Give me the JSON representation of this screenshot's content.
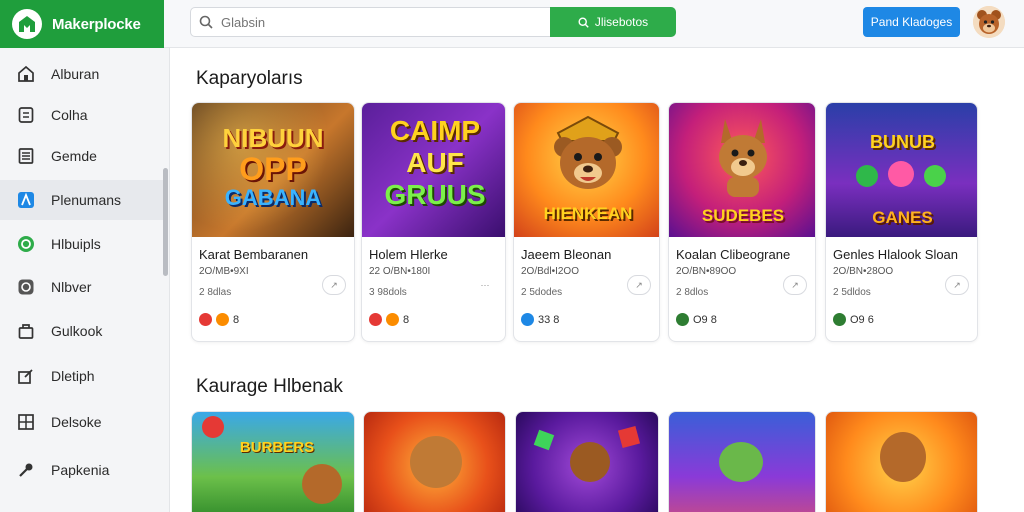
{
  "app": {
    "name": "Makerplocke"
  },
  "search": {
    "placeholder": "Glabsin",
    "button_label": "Jlisebotos"
  },
  "header": {
    "primary_button_label": "Pand Kladoges"
  },
  "sidebar": {
    "items": [
      {
        "label": "Alburan",
        "icon": "home-icon"
      },
      {
        "label": "Colha",
        "icon": "document-icon"
      },
      {
        "label": "Gemde",
        "icon": "list-icon"
      },
      {
        "label": "Plenumans",
        "icon": "profile-icon",
        "active": true
      },
      {
        "label": "Hlbuipls",
        "icon": "circle-icon"
      },
      {
        "label": "Nlbver",
        "icon": "chat-icon"
      },
      {
        "label": "Gulkook",
        "icon": "bag-icon"
      },
      {
        "label": "Dletiph",
        "icon": "edit-icon"
      },
      {
        "label": "Delsoke",
        "icon": "grid-icon"
      },
      {
        "label": "Papkenia",
        "icon": "tool-icon"
      }
    ]
  },
  "sections": [
    {
      "title": "Kaparyolarıs",
      "cards": [
        {
          "art_lines": [
            "NIBUUN",
            "OPP",
            "GABANA"
          ],
          "title": "Karat Bembaranen",
          "sub": "2O/MB•9XI",
          "meta": "2 8dlas",
          "stats": "8",
          "dot_colors": [
            "#e53935",
            "#fb8c00"
          ]
        },
        {
          "art_lines": [
            "CAIMP",
            "AUF",
            "GRUUS"
          ],
          "title": "Holem Hlerke",
          "sub": "22 O/BN•180I",
          "meta": "3 98dols",
          "stats": "8",
          "dot_colors": [
            "#e53935",
            "#fb8c00"
          ]
        },
        {
          "art_lines": [
            "HIENKEAN"
          ],
          "title": "Jaeem Bleonan",
          "sub": "2O/Bdl•I2OO",
          "meta": "2 5dodes",
          "stats": "33 8",
          "dot_colors": [
            "#1e88e5"
          ]
        },
        {
          "art_lines": [
            "SUDEBES"
          ],
          "title": "Koalan Clibeograne",
          "sub": "2O/BN•89OO",
          "meta": "2 8dlos",
          "stats": "O9 8",
          "dot_colors": [
            "#2e7d32"
          ]
        },
        {
          "art_lines": [
            "BUNUB",
            "GANES"
          ],
          "title": "Genles Hlalook Sloan",
          "sub": "2O/BN•28OO",
          "meta": "2 5dldos",
          "stats": "O9 6",
          "dot_colors": [
            "#2e7d32"
          ]
        }
      ]
    },
    {
      "title": "Kaurage Hlbenak",
      "cards": [
        {
          "art_lines": [
            "BURBERS"
          ]
        },
        {
          "art_lines": []
        },
        {
          "art_lines": []
        },
        {
          "art_lines": []
        },
        {
          "art_lines": []
        }
      ]
    }
  ],
  "colors": {
    "brand": "#1f9e3c",
    "accent": "#1e88e5",
    "search_button": "#2eac4a"
  }
}
